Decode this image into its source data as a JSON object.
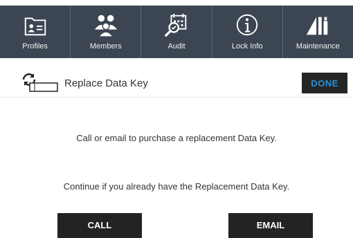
{
  "toolbar": {
    "items": [
      {
        "label": "Profiles",
        "icon": "profiles-icon"
      },
      {
        "label": "Members",
        "icon": "members-icon"
      },
      {
        "label": "Audit",
        "icon": "audit-icon"
      },
      {
        "label": "Lock Info",
        "icon": "info-icon"
      },
      {
        "label": "Maintenance",
        "icon": "maintenance-icon"
      }
    ]
  },
  "header": {
    "title": "Replace Data Key",
    "icon": "replace-data-key-icon",
    "done_label": "DONE"
  },
  "body": {
    "message_1": "Call or email to purchase a replacement Data Key.",
    "message_2": "Continue if you already have the Replacement Data Key."
  },
  "actions": {
    "call_label": "CALL",
    "email_label": "EMAIL"
  },
  "colors": {
    "toolbar_bg": "#3c4652",
    "button_bg": "#212325",
    "done_text": "#2a8fd6"
  }
}
